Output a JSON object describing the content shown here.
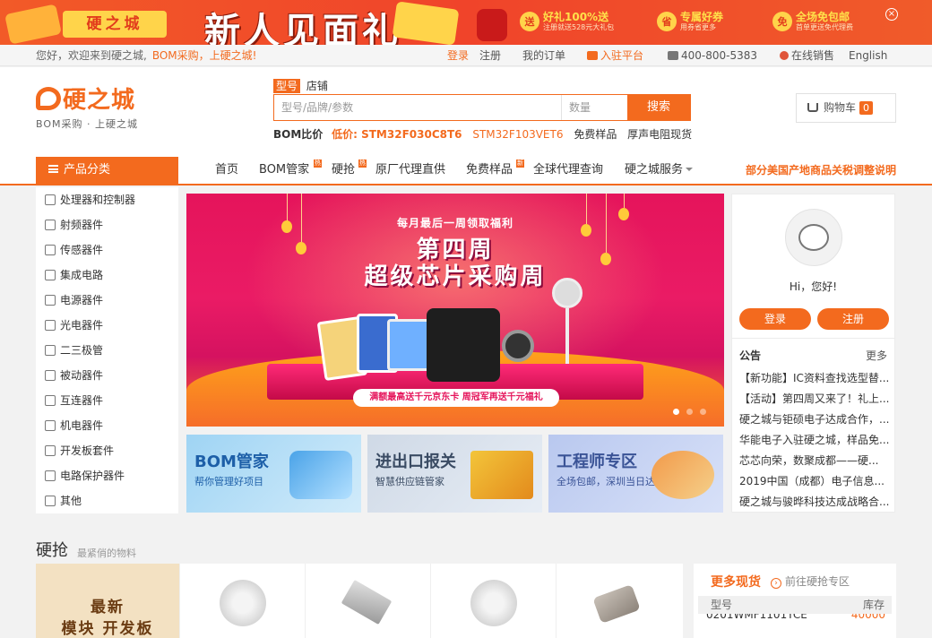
{
  "promo": {
    "left_tag": "硬之城",
    "title": "新人见面礼",
    "items": [
      {
        "icon": "送",
        "label": "好礼100%送",
        "sub": "注册就送528元大礼包"
      },
      {
        "icon": "省",
        "label": "专属好券",
        "sub": "用券省更多"
      },
      {
        "icon": "免",
        "label": "全场免包邮",
        "sub": "首单更送免代理费"
      }
    ],
    "close": "×"
  },
  "topbar": {
    "greeting": "您好，欢迎来到硬之城,",
    "slogan": "BOM采购，上硬之城!",
    "login": "登录",
    "register": "注册",
    "orders": "我的订单",
    "join": "入驻平台",
    "phone": "400-800-5383",
    "online_sales": "在线销售",
    "lang": "English"
  },
  "header": {
    "logo_name": "硬之城",
    "logo_slogan": "BOM采购 · 上硬之城",
    "tabs": [
      "型号",
      "店铺"
    ],
    "search_placeholder": "型号/品牌/参数",
    "qty_placeholder": "数量",
    "search_btn": "搜索",
    "hot_label": "BOM比价",
    "hot_price_label": "低价: STM32F030C8T6",
    "hot_link1": "STM32F103VET6",
    "hot_link2": "免费样品",
    "hot_link3": "厚声电阻现货",
    "cart_label": "购物车",
    "cart_count": "0"
  },
  "nav": {
    "category": "产品分类",
    "items": [
      "首页",
      "BOM管家",
      "硬抢",
      "原厂代理直供",
      "免费样品",
      "全球代理查询",
      "硬之城服务"
    ],
    "badges": [
      "热",
      "热",
      "新"
    ],
    "notice": "部分美国产地商品关税调整说明"
  },
  "sidebar": {
    "items": [
      "处理器和控制器",
      "射频器件",
      "传感器件",
      "集成电路",
      "电源器件",
      "光电器件",
      "二三极管",
      "被动器件",
      "互连器件",
      "机电器件",
      "开发板套件",
      "电路保护器件",
      "其他"
    ]
  },
  "banner": {
    "small": "每月最后一周领取福利",
    "title1": "第四周",
    "title2": "超级芯片采购周",
    "ribbon": "满额最高送千元京东卡 周冠军再送千元福礼"
  },
  "subbanners": [
    {
      "title": "BOM管家",
      "sub": "帮你管理好项目"
    },
    {
      "title": "进出口报关",
      "sub": "智慧供应链管家"
    },
    {
      "title": "工程师专区",
      "sub": "全场包邮，深圳当日达"
    }
  ],
  "rpanel": {
    "hi": "Hi，您好!",
    "login": "登录",
    "register": "注册",
    "announce": "公告",
    "more": "更多",
    "news": [
      "【新功能】IC资料查找选型替...",
      "【活动】第四周又来了！礼上...",
      "硬之城与钜硕电子达成合作，...",
      "华能电子入驻硬之城，样品免...",
      "芯芯向荣，数聚成都——硬...",
      "2019中国（成都）电子信息...",
      "硬之城与骏晔科技达成战略合..."
    ]
  },
  "hot": {
    "title": "硬抢",
    "subtitle": "最紧俏的物料",
    "promo_line1": "最新",
    "promo_line2": "模块 开发板"
  },
  "stock": {
    "title": "更多现货",
    "goto": "前往硬抢专区",
    "col1": "型号",
    "col2": "库存",
    "row_part": "0201WMF1101TCE",
    "row_qty": "40000"
  },
  "colors": {
    "accent": "#f36a1e",
    "banner_bg": "#e5145b"
  }
}
